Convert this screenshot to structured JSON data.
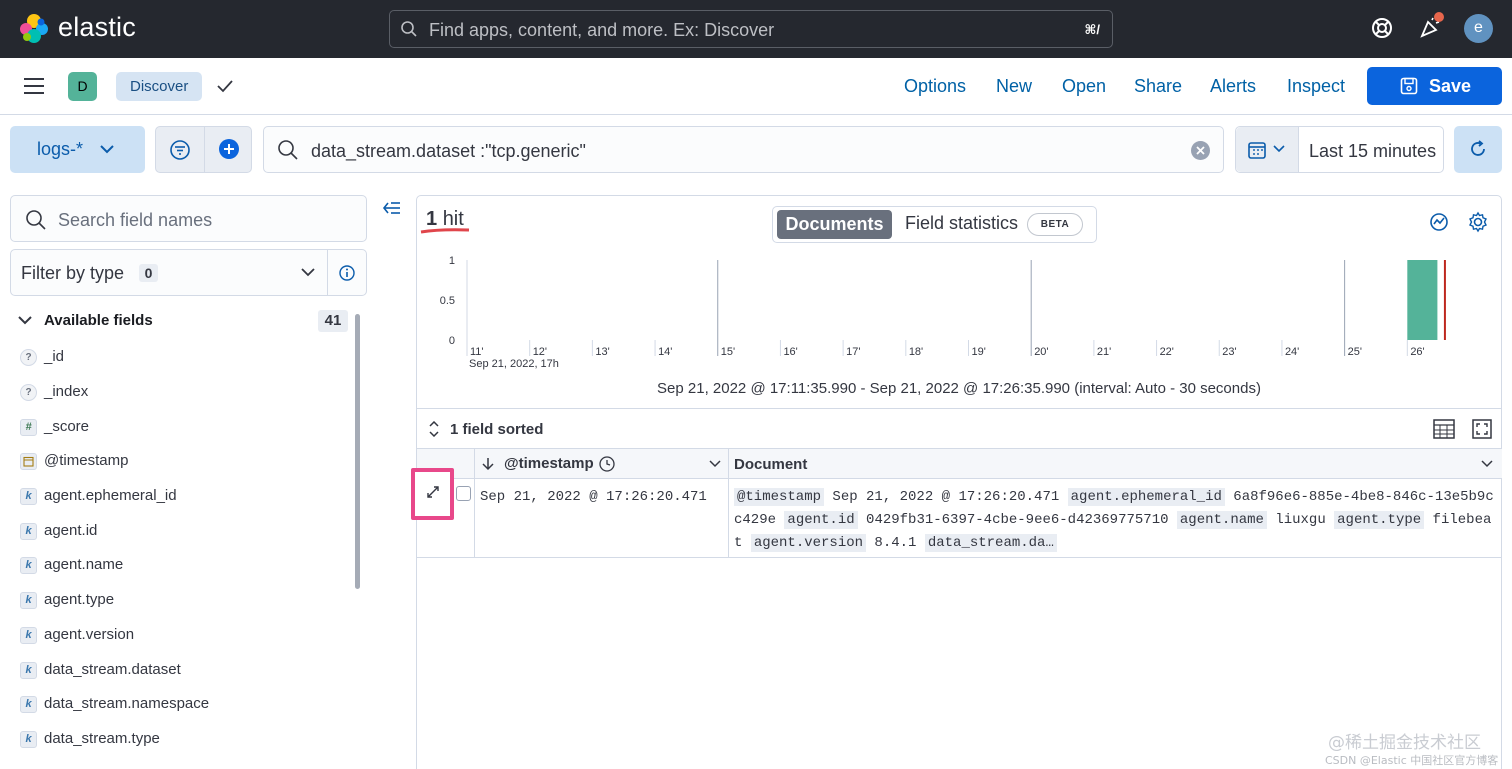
{
  "header": {
    "brand": "elastic",
    "search_placeholder": "Find apps, content, and more. Ex: Discover",
    "search_shortcut": "⌘/",
    "avatar_initial": "e"
  },
  "appbar": {
    "app_badge": "D",
    "breadcrumb": "Discover",
    "links": [
      "Options",
      "New",
      "Open",
      "Share",
      "Alerts",
      "Inspect"
    ],
    "save_label": "Save"
  },
  "querybar": {
    "data_view": "logs-*",
    "query": "data_stream.dataset :\"tcp.generic\"",
    "time_range": "Last 15 minutes"
  },
  "sidebar": {
    "search_placeholder": "Search field names",
    "filter_label": "Filter by type",
    "filter_count": "0",
    "available_label": "Available fields",
    "available_count": "41",
    "fields": [
      {
        "type": "?",
        "name": "_id"
      },
      {
        "type": "?",
        "name": "_index"
      },
      {
        "type": "#",
        "name": "_score"
      },
      {
        "type": "date",
        "name": "@timestamp"
      },
      {
        "type": "k",
        "name": "agent.ephemeral_id"
      },
      {
        "type": "k",
        "name": "agent.id"
      },
      {
        "type": "k",
        "name": "agent.name"
      },
      {
        "type": "k",
        "name": "agent.type"
      },
      {
        "type": "k",
        "name": "agent.version"
      },
      {
        "type": "k",
        "name": "data_stream.dataset"
      },
      {
        "type": "k",
        "name": "data_stream.namespace"
      },
      {
        "type": "k",
        "name": "data_stream.type"
      }
    ]
  },
  "main": {
    "hits_count": "1",
    "hits_label": "hit",
    "tab_documents": "Documents",
    "tab_field_stats": "Field statistics",
    "beta_badge": "BETA",
    "interval_text": "Sep 21, 2022 @ 17:11:35.990 - Sep 21, 2022 @ 17:26:35.990 (interval: Auto - 30 seconds)",
    "sorted_label": "1 field sorted",
    "col_timestamp": "@timestamp",
    "col_document": "Document",
    "row_timestamp": "Sep 21, 2022 @ 17:26:20.471",
    "row_document": [
      {
        "k": "@timestamp",
        "v": "Sep 21, 2022 @ 17:26:20.471"
      },
      {
        "k": "agent.ephemeral_id",
        "v": "6a8f96e6-885e-4be8-846c-13e5b9cc429e"
      },
      {
        "k": "agent.id",
        "v": "0429fb31-6397-4cbe-9ee6-d42369775710"
      },
      {
        "k": "agent.name",
        "v": "liuxgu"
      },
      {
        "k": "agent.type",
        "v": "filebeat"
      },
      {
        "k": "agent.version",
        "v": "8.4.1"
      },
      {
        "k": "data_stream.da…",
        "v": ""
      }
    ]
  },
  "chart_data": {
    "type": "bar",
    "x_ticks": [
      "11'",
      "12'",
      "13'",
      "14'",
      "15'",
      "16'",
      "17'",
      "18'",
      "19'",
      "20'",
      "21'",
      "22'",
      "23'",
      "24'",
      "25'",
      "26'"
    ],
    "x_sublabel": "Sep 21, 2022, 17h",
    "y_ticks": [
      "0",
      "0.5",
      "1"
    ],
    "ylim": [
      0,
      1
    ],
    "values": [
      0,
      0,
      0,
      0,
      0,
      0,
      0,
      0,
      0,
      0,
      0,
      0,
      0,
      0,
      0,
      1
    ],
    "bar_color": "#54b399",
    "now_marker_color": "#bd271e"
  },
  "watermark": {
    "line1": "@稀土掘金技术社区",
    "line2": "CSDN @Elastic 中国社区官方博客"
  }
}
